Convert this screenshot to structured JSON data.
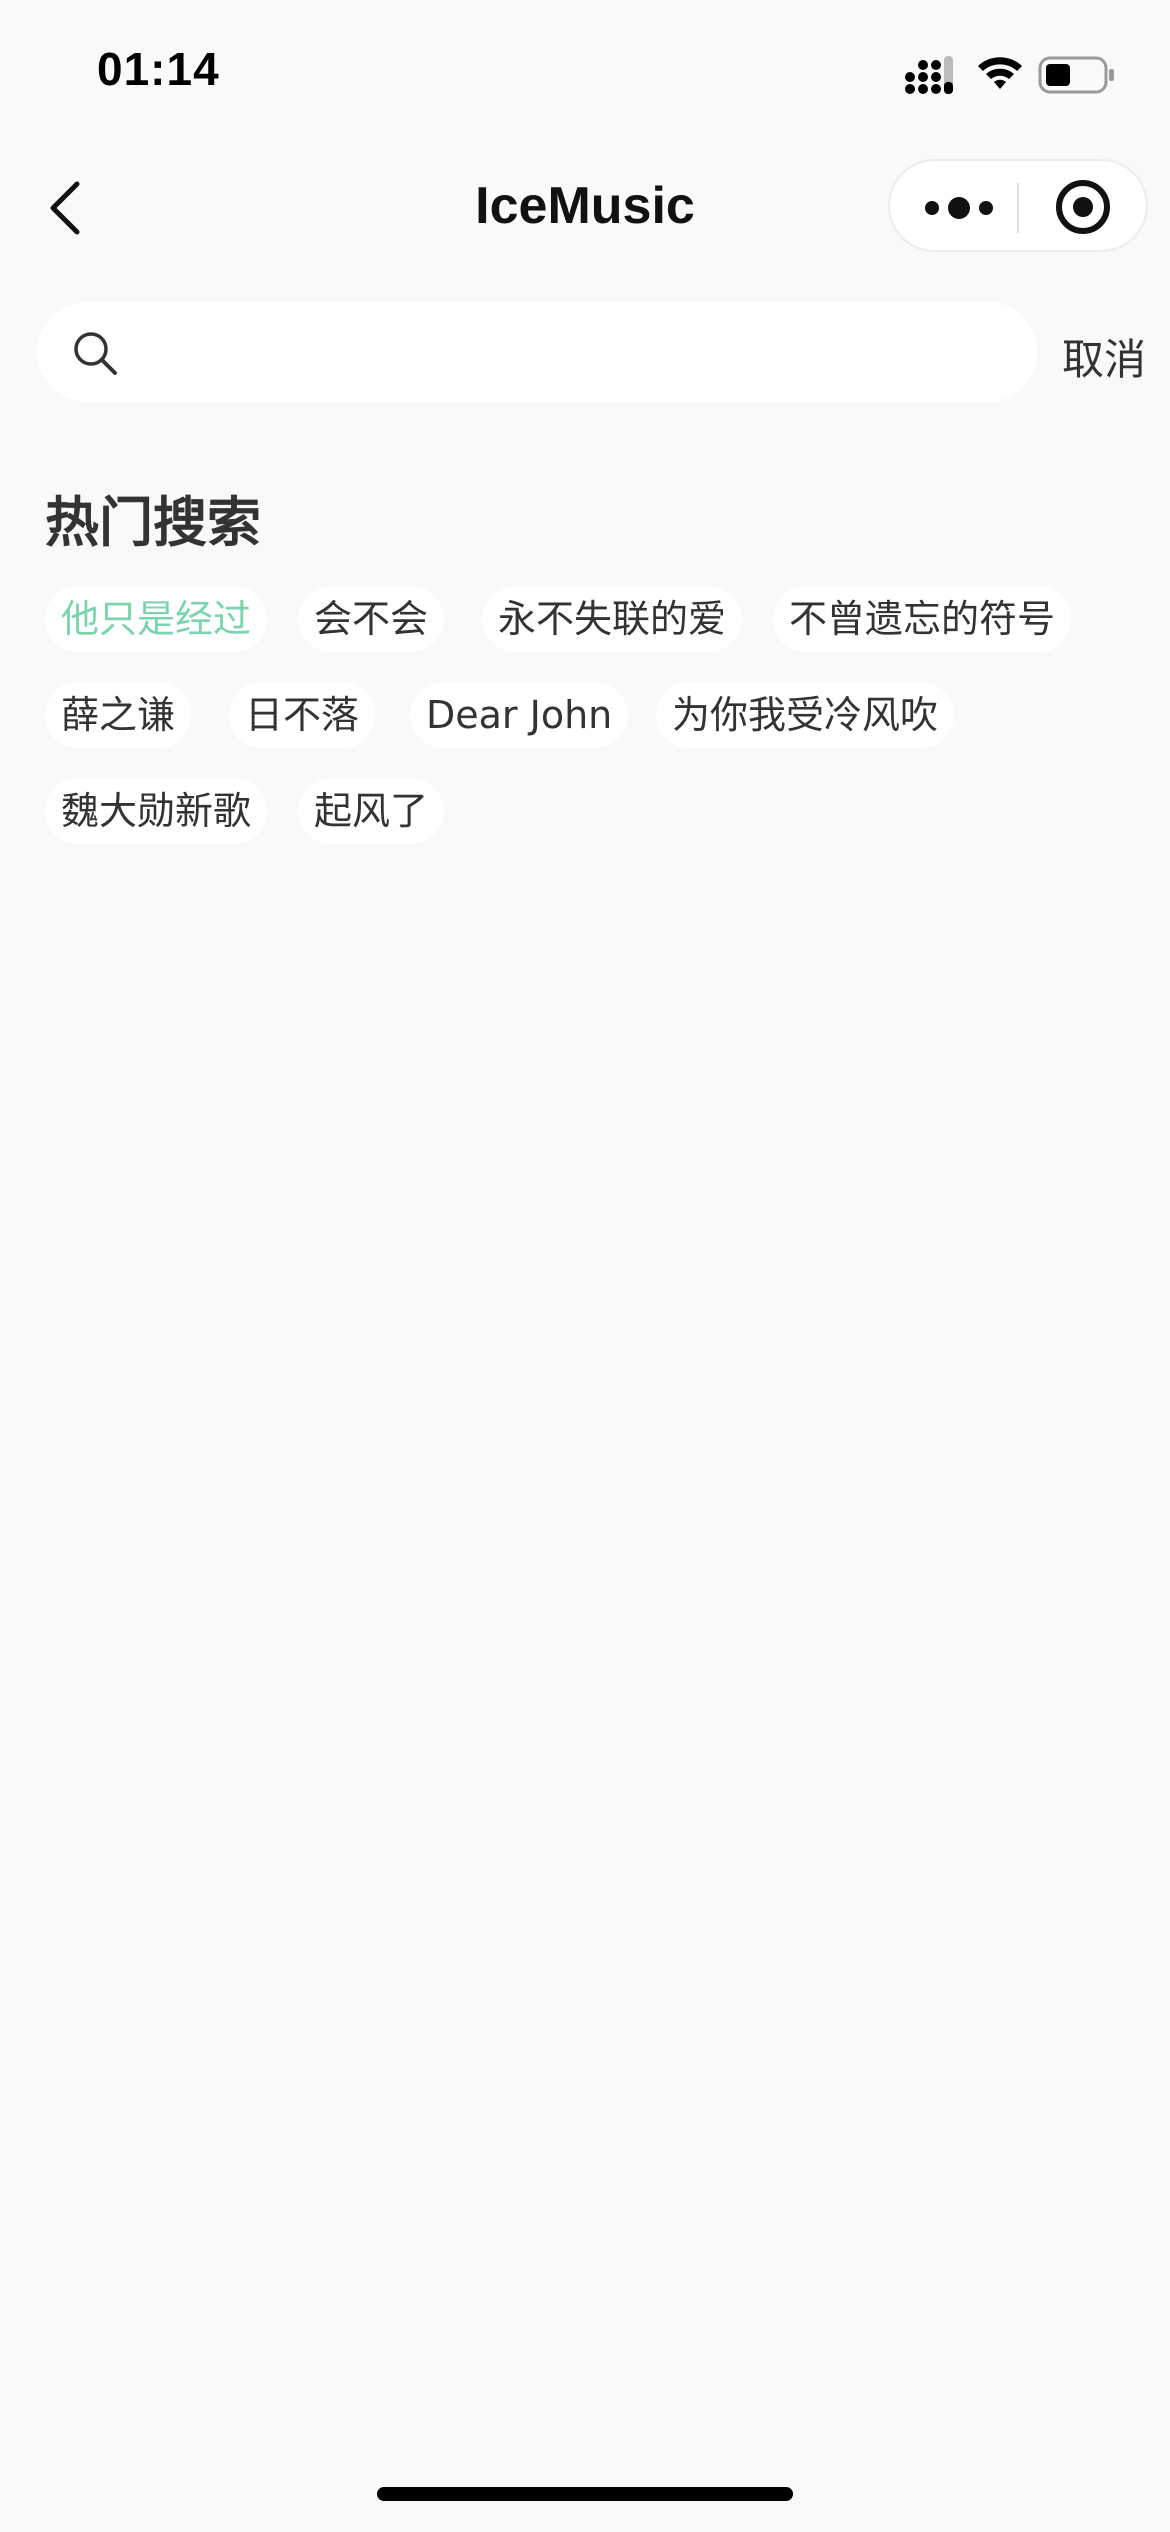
{
  "status_bar": {
    "time": "01:14"
  },
  "nav": {
    "title": "IceMusic"
  },
  "search": {
    "placeholder": "",
    "value": "",
    "cancel_label": "取消"
  },
  "hot_search": {
    "title": "热门搜索",
    "tags": [
      {
        "label": "他只是经过",
        "active": true
      },
      {
        "label": "会不会"
      },
      {
        "label": "永不失联的爱"
      },
      {
        "label": "不曾遗忘的符号"
      },
      {
        "label": "薛之谦"
      },
      {
        "label": "日不落"
      },
      {
        "label": "Dear John"
      },
      {
        "label": "为你我受冷风吹"
      },
      {
        "label": "魏大勋新歌"
      },
      {
        "label": "起风了"
      }
    ]
  },
  "colors": {
    "accent": "#7dd3ae",
    "background": "#f9f9f9"
  }
}
